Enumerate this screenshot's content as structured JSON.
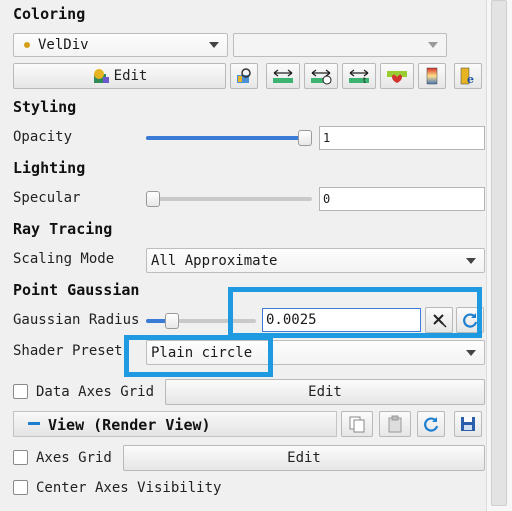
{
  "coloring": {
    "header": "Coloring",
    "array": "VelDiv",
    "component": "",
    "edit_label": "Edit"
  },
  "styling": {
    "header": "Styling",
    "opacity_label": "Opacity",
    "opacity_value": "1",
    "opacity_fraction": 1.0
  },
  "lighting": {
    "header": "Lighting",
    "specular_label": "Specular",
    "specular_value": "0",
    "specular_fraction": 0.0
  },
  "ray_tracing": {
    "header": "Ray Tracing",
    "scaling_mode_label": "Scaling Mode",
    "scaling_mode_value": "All Approximate"
  },
  "point_gaussian": {
    "header": "Point Gaussian",
    "radius_label": "Gaussian Radius",
    "radius_value": "0.0025",
    "radius_fraction": 0.2,
    "shader_label": "Shader Preset",
    "shader_value": "Plain circle"
  },
  "data_axes_grid": {
    "label": "Data Axes Grid",
    "checked": false,
    "edit_label": "Edit"
  },
  "view": {
    "header": "View (Render View)",
    "toggle": "−"
  },
  "axes_grid": {
    "label": "Axes Grid",
    "checked": false,
    "edit_label": "Edit"
  },
  "center_axes": {
    "label": "Center Axes Visibility",
    "checked": false
  },
  "colors": {
    "accent": "#3a7bd5",
    "highlight": "#1e9be0"
  }
}
